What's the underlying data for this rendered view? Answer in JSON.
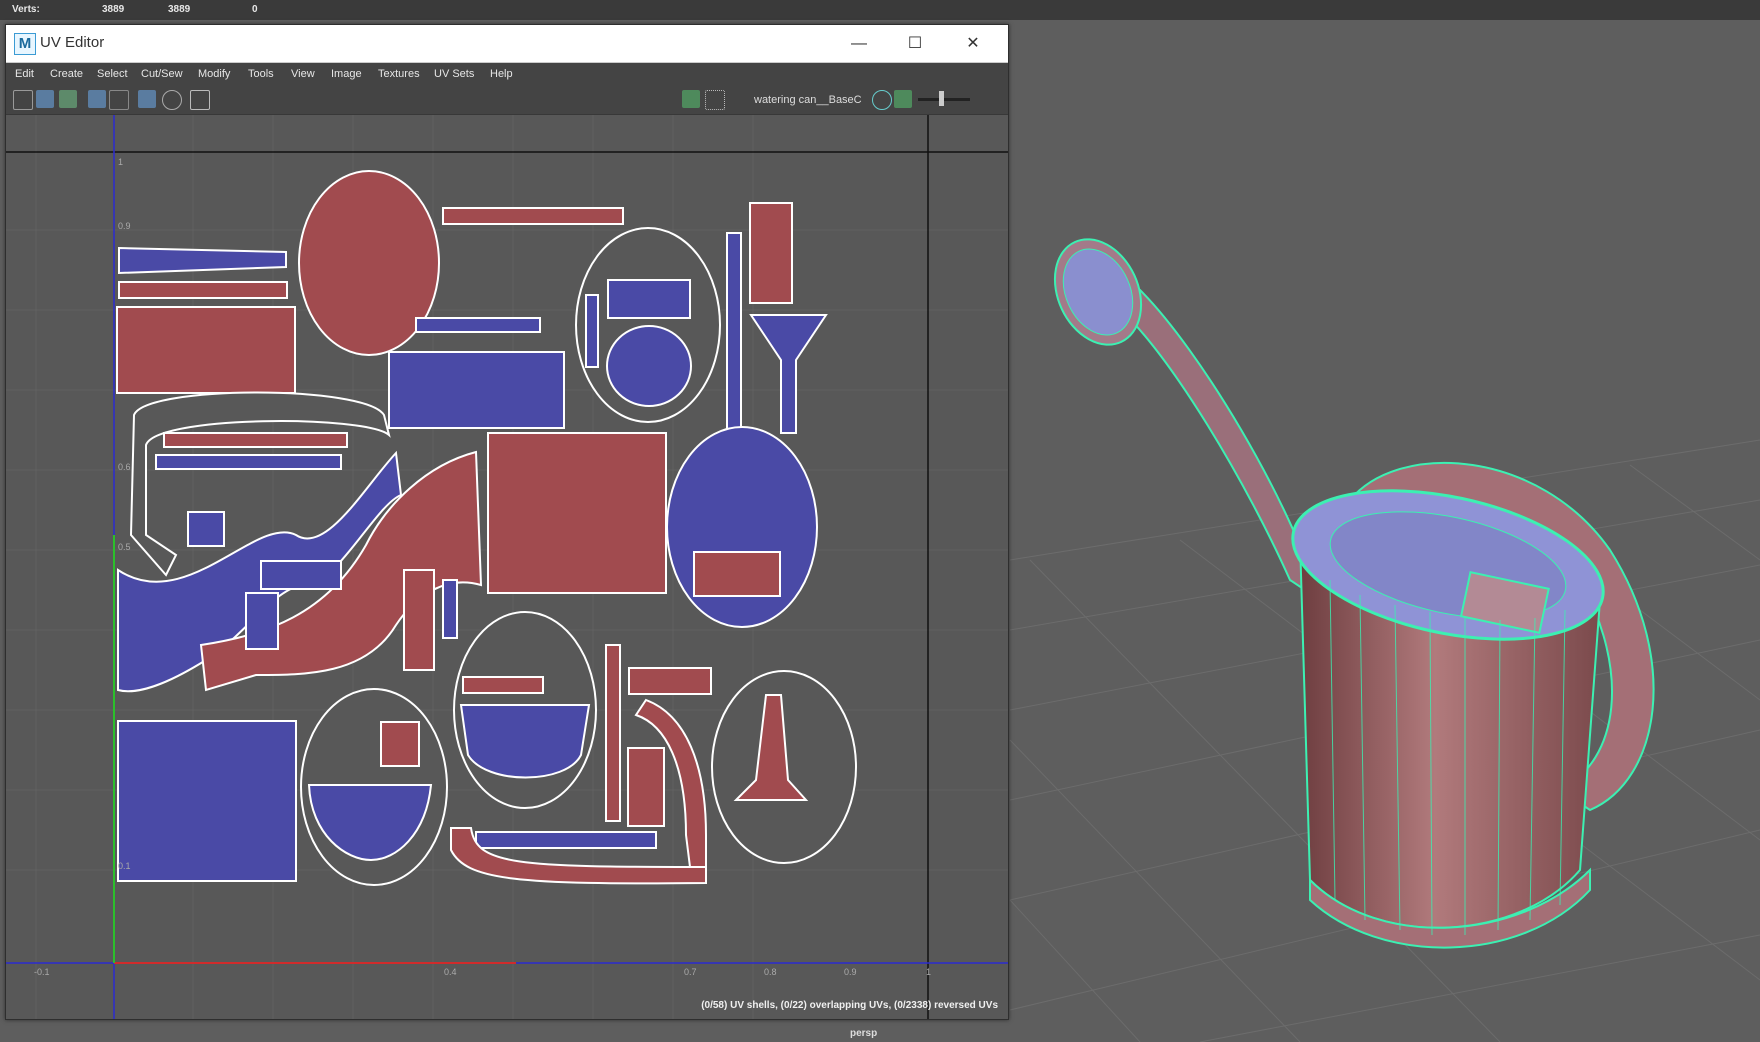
{
  "hud": {
    "label": "Verts:",
    "v1": "3889",
    "v2": "3889",
    "v3": "0"
  },
  "viewport": {
    "camera": "persp",
    "bg": "#5e5e5e",
    "grid": "#6a6a6a"
  },
  "window": {
    "title": "UV Editor",
    "logo": "M",
    "minimize": "—",
    "maximize": "☐",
    "close": "✕"
  },
  "menu": [
    "Edit",
    "Create",
    "Select",
    "Cut/Sew",
    "Modify",
    "Tools",
    "View",
    "Image",
    "Textures",
    "UV Sets",
    "Help"
  ],
  "toolbar": {
    "texture_name": "watering can__BaseC"
  },
  "uv": {
    "ticks_y": [
      "1",
      "0.9",
      "0.6",
      "0.5",
      "0.1"
    ],
    "ticks_x": [
      "-0.1",
      "0.4",
      "0.7",
      "0.8",
      "0.9",
      "1"
    ],
    "status": "(0/58) UV shells, (0/22) overlapping UVs, (0/2338) reversed UVs",
    "colors": {
      "red": "#a14b4f",
      "blue": "#4a4aa6",
      "wire": "#ffffff"
    }
  }
}
